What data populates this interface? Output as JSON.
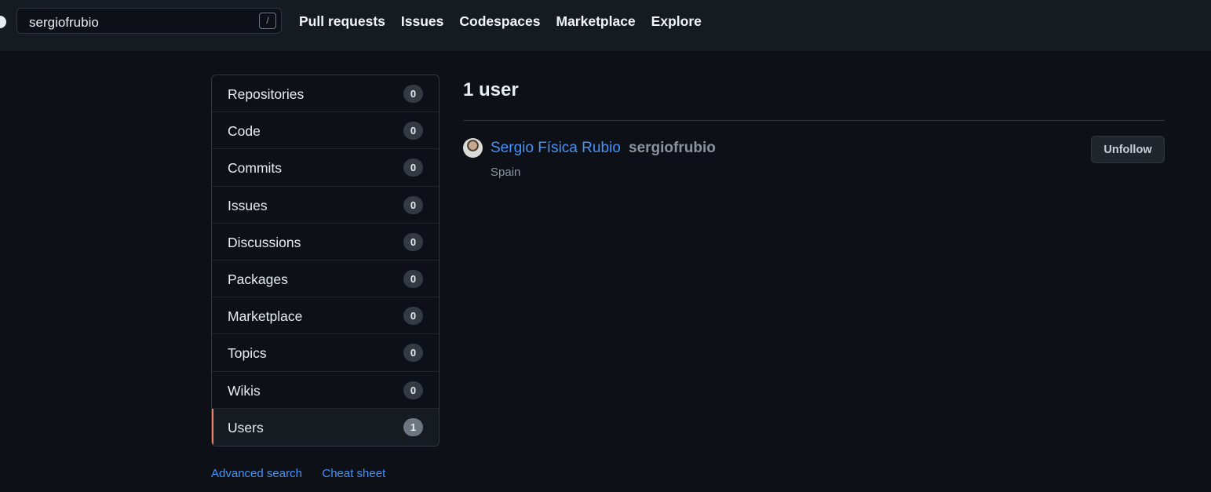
{
  "header": {
    "search": {
      "value": "sergiofrubio",
      "shortcut_key": "/"
    },
    "nav": [
      "Pull requests",
      "Issues",
      "Codespaces",
      "Marketplace",
      "Explore"
    ]
  },
  "sidebar": {
    "items": [
      {
        "label": "Repositories",
        "count": "0"
      },
      {
        "label": "Code",
        "count": "0"
      },
      {
        "label": "Commits",
        "count": "0"
      },
      {
        "label": "Issues",
        "count": "0"
      },
      {
        "label": "Discussions",
        "count": "0"
      },
      {
        "label": "Packages",
        "count": "0"
      },
      {
        "label": "Marketplace",
        "count": "0"
      },
      {
        "label": "Topics",
        "count": "0"
      },
      {
        "label": "Wikis",
        "count": "0"
      },
      {
        "label": "Users",
        "count": "1",
        "selected": true
      }
    ],
    "footer_links": [
      "Advanced search",
      "Cheat sheet"
    ]
  },
  "results": {
    "title": "1 user",
    "users": [
      {
        "name": "Sergio Física Rubio",
        "login": "sergiofrubio",
        "location": "Spain",
        "action": "Unfollow"
      }
    ]
  },
  "colors": {
    "background": "#0d1117",
    "header": "#161b22",
    "link": "#4493f8",
    "selected_accent": "#f78166"
  }
}
